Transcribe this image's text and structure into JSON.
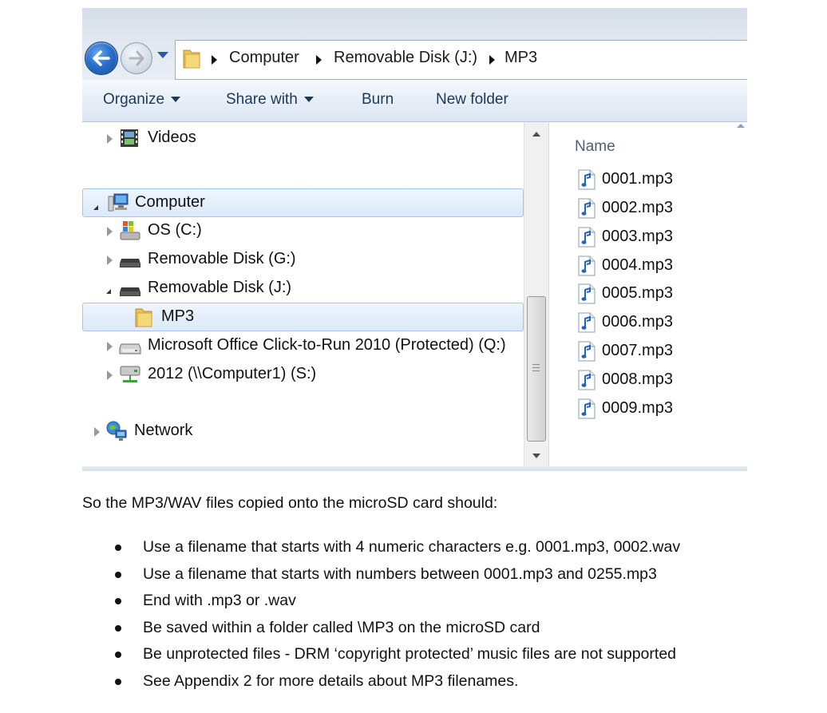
{
  "address_bar": {
    "breadcrumbs": [
      "Computer",
      "Removable Disk (J:)",
      "MP3"
    ]
  },
  "toolbar": {
    "items": [
      {
        "label": "Organize",
        "has_dropdown": true
      },
      {
        "label": "Share with",
        "has_dropdown": true
      },
      {
        "label": "Burn",
        "has_dropdown": false
      },
      {
        "label": "New folder",
        "has_dropdown": false
      }
    ]
  },
  "nav_tree": {
    "items": [
      {
        "label": "Videos",
        "icon": "videos-icon",
        "expander": "collapsed",
        "selected": false
      },
      {
        "label": "Computer",
        "icon": "computer-icon",
        "expander": "expanded",
        "selected": true
      },
      {
        "label": "OS (C:)",
        "icon": "os-drive-icon",
        "expander": "collapsed",
        "selected": false
      },
      {
        "label": "Removable Disk (G:)",
        "icon": "removable-disk-icon",
        "expander": "collapsed",
        "selected": false
      },
      {
        "label": "Removable Disk (J:)",
        "icon": "removable-disk-icon",
        "expander": "expanded",
        "selected": false
      },
      {
        "label": "MP3",
        "icon": "folder-icon",
        "expander": "none",
        "selected": true
      },
      {
        "label": "Microsoft Office Click-to-Run 2010 (Protected) (Q:)",
        "icon": "drive-icon",
        "expander": "collapsed",
        "selected": false
      },
      {
        "label": "2012 (\\\\Computer1) (S:)",
        "icon": "network-drive-icon",
        "expander": "collapsed",
        "selected": false
      },
      {
        "label": "Network",
        "icon": "network-icon",
        "expander": "collapsed",
        "selected": false
      }
    ]
  },
  "file_list": {
    "column_header": "Name",
    "files": [
      "0001.mp3",
      "0002.mp3",
      "0003.mp3",
      "0004.mp3",
      "0005.mp3",
      "0006.mp3",
      "0007.mp3",
      "0008.mp3",
      "0009.mp3"
    ]
  },
  "document": {
    "intro": "So the MP3/WAV files copied onto the microSD card should:",
    "bullets": [
      "Use a filename that starts with 4 numeric characters e.g. 0001.mp3, 0002.wav",
      "Use a filename that starts with numbers between 0001.mp3 and 0255.mp3",
      "End with .mp3 or .wav",
      "Be saved within a folder called \\MP3 on the microSD card",
      "Be unprotected files - DRM ‘copyright protected’ music files are not supported",
      "See Appendix 2 for more details about MP3 filenames."
    ]
  },
  "colors": {
    "toolbar_text": "#1e3956",
    "selection_fill": "#dbe9f9",
    "selection_border": "#a9c6ea",
    "back_button": "#2a6fcc"
  }
}
